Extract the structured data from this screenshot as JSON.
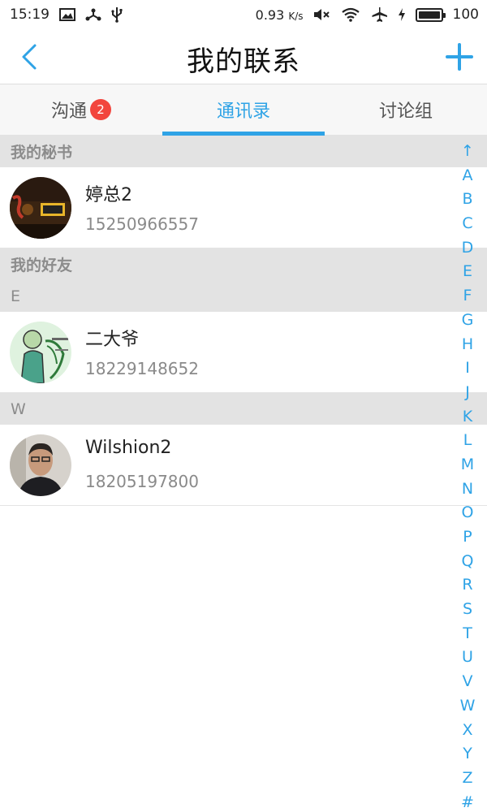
{
  "status_bar": {
    "time": "15:19",
    "network_speed": "0.93",
    "network_speed_unit": "K/s",
    "battery_level": "100"
  },
  "header": {
    "title": "我的联系"
  },
  "tabs": [
    {
      "label": "沟通",
      "badge": "2",
      "active": false
    },
    {
      "label": "通讯录",
      "active": true
    },
    {
      "label": "讨论组",
      "active": false
    }
  ],
  "sections": {
    "secretary": {
      "title": "我的秘书",
      "contact": {
        "name": "婷总2",
        "phone": "15250966557"
      }
    },
    "friends": {
      "title": "我的好友",
      "groups": [
        {
          "letter": "E",
          "contact": {
            "name": "二大爷",
            "phone": "18229148652"
          }
        },
        {
          "letter": "W",
          "contact": {
            "name": "Wilshion2",
            "phone": "18205197800"
          }
        }
      ]
    }
  },
  "index_bar": [
    "↑",
    "A",
    "B",
    "C",
    "D",
    "E",
    "F",
    "G",
    "H",
    "I",
    "J",
    "K",
    "L",
    "M",
    "N",
    "O",
    "P",
    "Q",
    "R",
    "S",
    "T",
    "U",
    "V",
    "W",
    "X",
    "Y",
    "Z",
    "#"
  ],
  "colors": {
    "accent": "#2fa3e6",
    "badge": "#f2453d",
    "section_bg": "#e3e3e3"
  }
}
